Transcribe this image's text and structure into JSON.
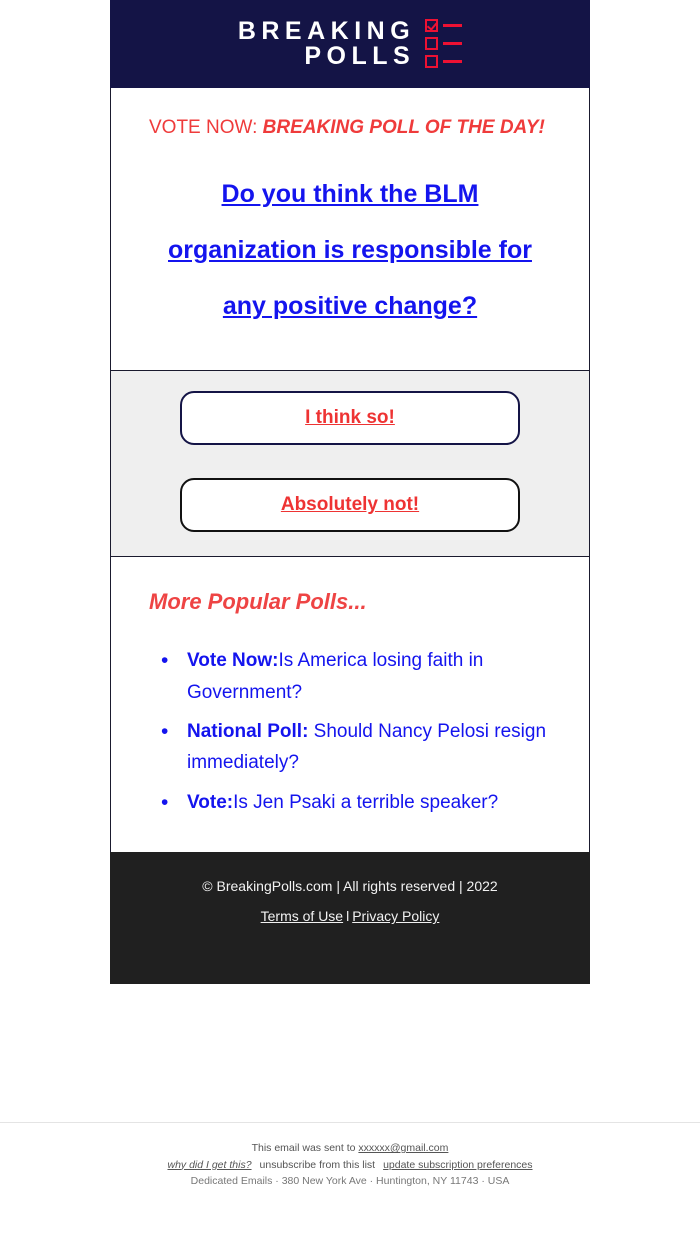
{
  "brand": {
    "logo_line1": "BREAKING",
    "logo_line2": "POLLS",
    "navy": "#141446",
    "red": "#ee1133",
    "link_blue": "#1414ee"
  },
  "poll": {
    "kicker_prefix": "VOTE NOW: ",
    "kicker_emphasis": "BREAKING POLL OF THE DAY!",
    "question": "Do you think the BLM organization is responsible for any positive change?",
    "answers": [
      {
        "label": "I think so!"
      },
      {
        "label": "Absolutely not!"
      }
    ]
  },
  "more_polls": {
    "title": "More Popular Polls...",
    "items": [
      {
        "lead": "Vote Now:",
        "text": "Is America losing faith in Government?"
      },
      {
        "lead": "National Poll:",
        "text": " Should Nancy Pelosi resign immediately?"
      },
      {
        "lead": "Vote:",
        "text": "Is Jen Psaki a terrible speaker?"
      }
    ]
  },
  "footer": {
    "copyright": "© BreakingPolls.com | All rights reserved | 2022",
    "terms_label": "Terms of Use",
    "separator": "l",
    "privacy_label": "Privacy Policy"
  },
  "unsubscribe": {
    "sent_to_prefix": "This email was sent to ",
    "recipient_email": "xxxxxx@gmail.com",
    "why_link": "why did I get this?",
    "unsubscribe_link": "unsubscribe from this list",
    "preferences_link": "update subscription preferences",
    "address": "Dedicated Emails · 380 New York Ave · Huntington, NY 11743 · USA"
  }
}
